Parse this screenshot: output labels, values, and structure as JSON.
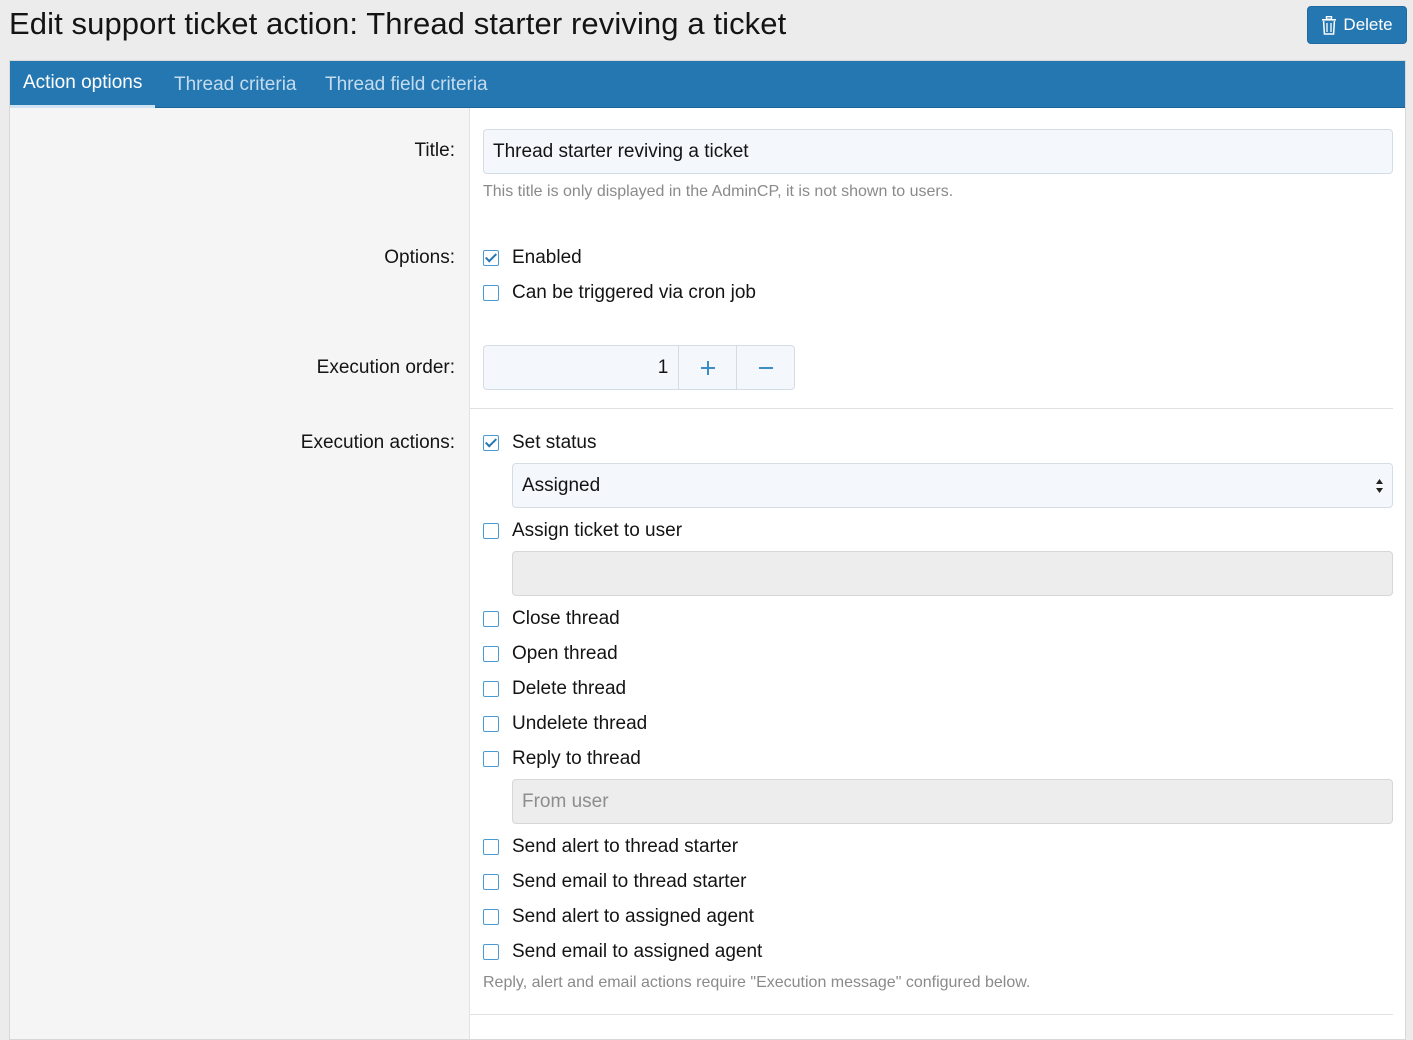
{
  "header": {
    "title": "Edit support ticket action: Thread starter reviving a ticket",
    "delete_label": "Delete"
  },
  "tabs": [
    {
      "label": "Action options",
      "active": true
    },
    {
      "label": "Thread criteria",
      "active": false
    },
    {
      "label": "Thread field criteria",
      "active": false
    }
  ],
  "form": {
    "title_label": "Title:",
    "title_value": "Thread starter reviving a ticket",
    "title_hint": "This title is only displayed in the AdminCP, it is not shown to users.",
    "options_label": "Options:",
    "options": [
      {
        "label": "Enabled",
        "checked": true
      },
      {
        "label": "Can be triggered via cron job",
        "checked": false
      }
    ],
    "execution_order_label": "Execution order:",
    "execution_order_value": "1",
    "execution_actions_label": "Execution actions:",
    "actions": {
      "set_status": {
        "label": "Set status",
        "checked": true
      },
      "status_select": "Assigned",
      "assign_ticket": {
        "label": "Assign ticket to user",
        "checked": false
      },
      "assign_user_value": "",
      "close_thread": {
        "label": "Close thread",
        "checked": false
      },
      "open_thread": {
        "label": "Open thread",
        "checked": false
      },
      "delete_thread": {
        "label": "Delete thread",
        "checked": false
      },
      "undelete_thread": {
        "label": "Undelete thread",
        "checked": false
      },
      "reply_thread": {
        "label": "Reply to thread",
        "checked": false
      },
      "from_user_placeholder": "From user",
      "alert_starter": {
        "label": "Send alert to thread starter",
        "checked": false
      },
      "email_starter": {
        "label": "Send email to thread starter",
        "checked": false
      },
      "alert_agent": {
        "label": "Send alert to assigned agent",
        "checked": false
      },
      "email_agent": {
        "label": "Send email to assigned agent",
        "checked": false
      }
    },
    "actions_hint": "Reply, alert and email actions require \"Execution message\" configured below."
  },
  "colors": {
    "accent": "#2577b1",
    "tab_inactive_text": "#c4dcef",
    "page_background": "#ececec"
  }
}
